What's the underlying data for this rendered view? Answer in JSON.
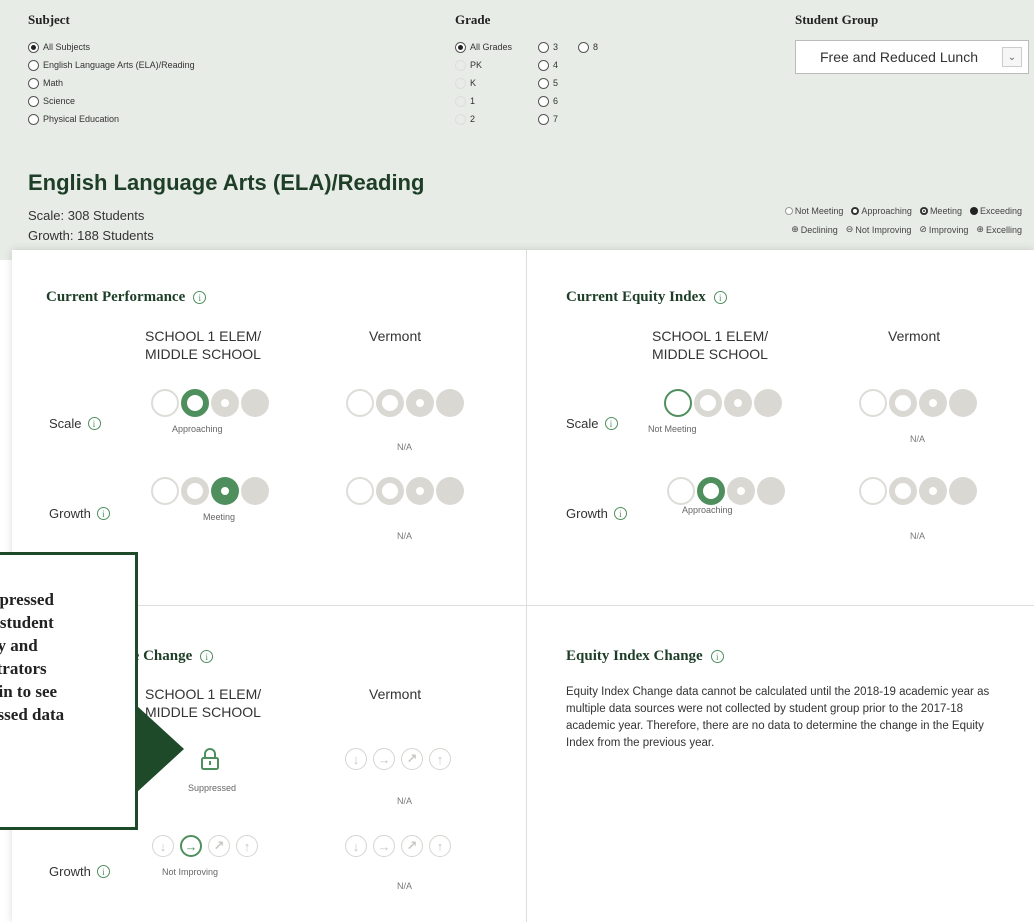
{
  "filters": {
    "subject": {
      "header": "Subject",
      "options": [
        "All Subjects",
        "English Language Arts (ELA)/Reading",
        "Math",
        "Science",
        "Physical Education"
      ],
      "selected": "All Subjects"
    },
    "grade": {
      "header": "Grade",
      "col1": [
        "All Grades",
        "PK",
        "K",
        "1",
        "2"
      ],
      "col2": [
        "3",
        "4",
        "5",
        "6",
        "7"
      ],
      "col3": [
        "8"
      ],
      "selected": "All Grades"
    },
    "student_group": {
      "header": "Student Group",
      "value": "Free and Reduced Lunch",
      "arrow": "⌄"
    }
  },
  "section": {
    "title": "English Language Arts (ELA)/Reading",
    "scale": "Scale: 308 Students",
    "growth": "Growth: 188 Students"
  },
  "legend": {
    "performance": [
      "Not Meeting",
      "Approaching",
      "Meeting",
      "Exceeding"
    ],
    "change": [
      "Declining",
      "Not Improving",
      "Improving",
      "Excelling"
    ]
  },
  "columns": {
    "school_line1": "SCHOOL 1 ELEM/",
    "school_line2": "MIDDLE SCHOOL",
    "state": "Vermont"
  },
  "rows": {
    "scale": "Scale",
    "growth": "Growth"
  },
  "current_performance": {
    "title": "Current Performance",
    "scale_school": "Approaching",
    "growth_school": "Meeting",
    "state_scale": "N/A",
    "state_growth": "N/A"
  },
  "current_equity": {
    "title": "Current Equity Index",
    "scale_school": "Not Meeting",
    "growth_school": "Approaching",
    "state_scale": "N/A",
    "state_growth": "N/A"
  },
  "performance_change": {
    "title_partial": "ce Change",
    "scale_school": "Suppressed",
    "growth_school": "Not Improving",
    "state_scale": "N/A",
    "state_growth": "N/A"
  },
  "equity_change": {
    "title": "Equity Index Change",
    "text": "Equity Index Change data cannot be calculated until the 2018-19 academic year as multiple data sources were not collected by student group prior to the 2017-18 academic year. Therefore, there are no data to determine the change in the Equity Index from the previous year."
  },
  "callout": {
    "lines": [
      "ppressed",
      "t student",
      "cy and",
      "strators",
      "gin to see",
      "essed data"
    ]
  },
  "colors": {
    "accent": "#4f8f5e",
    "dark_green": "#1e4a2a",
    "inactive": "#d9d8d3"
  }
}
